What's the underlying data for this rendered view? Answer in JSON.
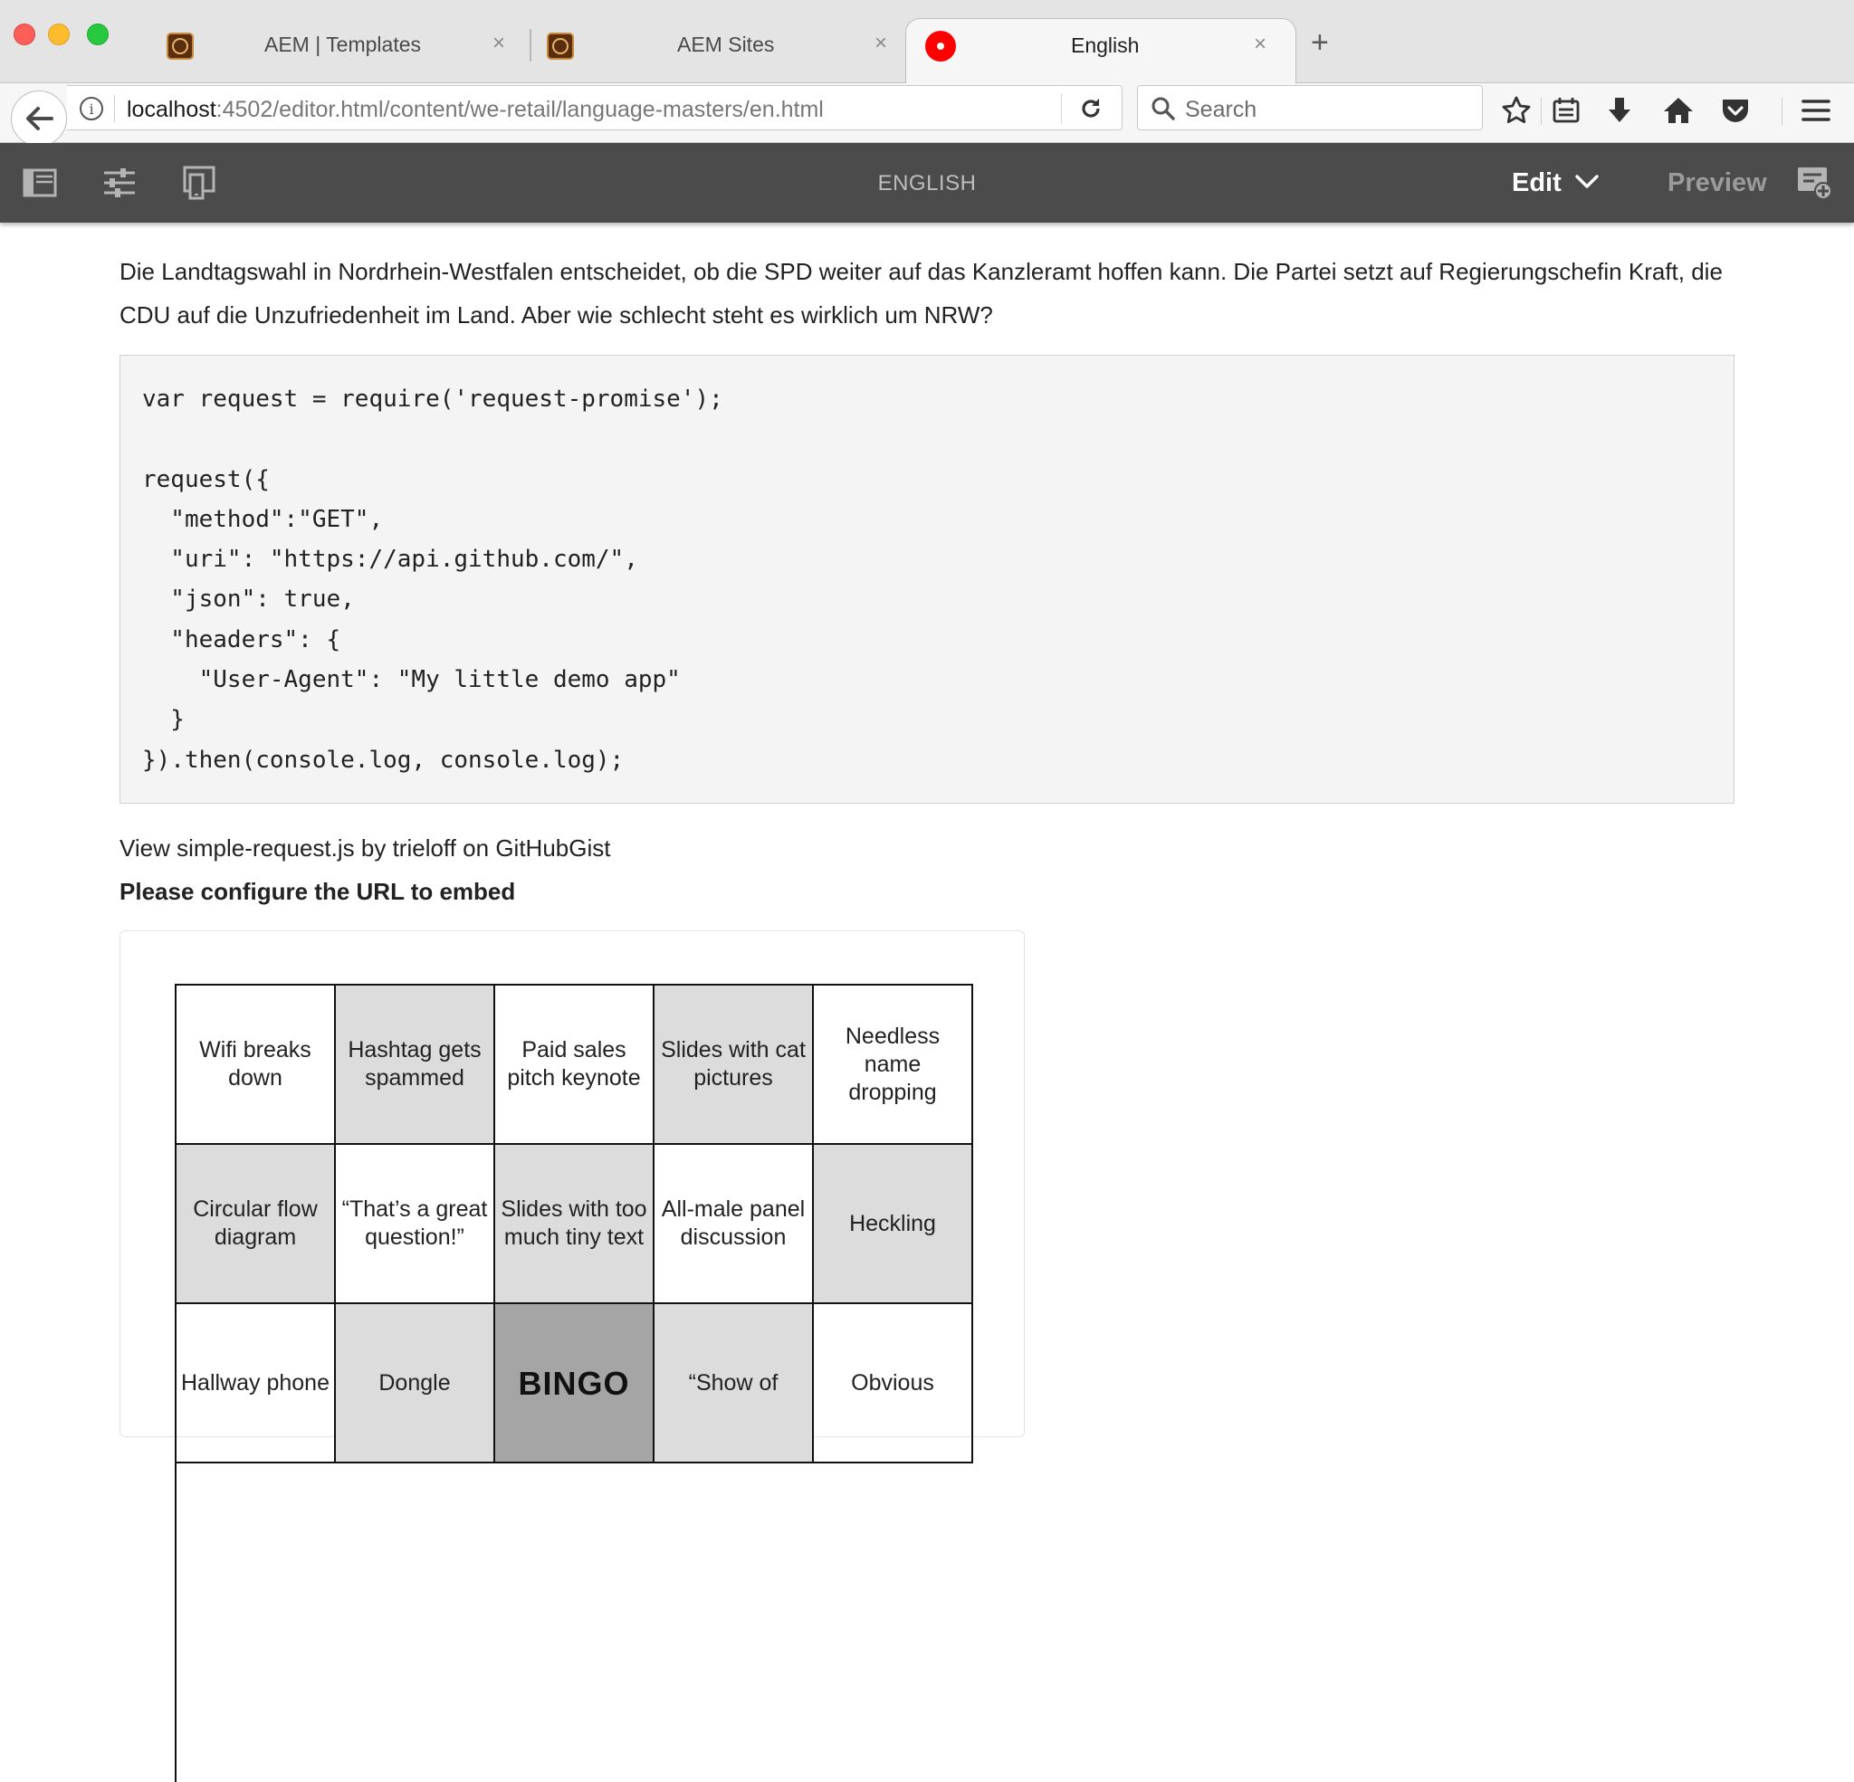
{
  "browser": {
    "tabs": [
      {
        "label": "AEM | Templates",
        "close": "×"
      },
      {
        "label": "AEM Sites",
        "close": "×"
      },
      {
        "label": "English",
        "close": "×",
        "active": true
      }
    ],
    "new_tab": "+",
    "url_host": "localhost",
    "url_path": ":4502/editor.html/content/we-retail/language-masters/en.html",
    "search_placeholder": "Search",
    "favicon_record_color": "#ff0000"
  },
  "aem": {
    "page_title": "ENGLISH",
    "mode": "Edit",
    "preview": "Preview",
    "toolbar_bg": "#4b4b4b"
  },
  "content": {
    "intro": "Die Landtagswahl in Nordrhein-Westfalen entscheidet, ob die SPD weiter auf das Kanzleramt hoffen kann. Die Partei setzt auf Regierungschefin Kraft, die CDU auf die Unzufriedenheit im Land. Aber wie schlecht steht es wirklich um NRW?",
    "code": "var request = require('request-promise');\n\nrequest({\n  \"method\":\"GET\",\n  \"uri\": \"https://api.github.com/\",\n  \"json\": true,\n  \"headers\": {\n    \"User-Agent\": \"My little demo app\"\n  }\n}).then(console.log, console.log);",
    "gist": {
      "view": "View",
      "file": "simple-request.js",
      "by": "by",
      "author": "trieloff",
      "on": "on",
      "service": "GitHubGist"
    },
    "configure": "Please configure the URL to embed",
    "bingo": [
      {
        "text": "Wifi breaks down",
        "shade": "white"
      },
      {
        "text": "Hashtag gets spammed",
        "shade": "grey"
      },
      {
        "text": "Paid sales pitch keynote",
        "shade": "white"
      },
      {
        "text": "Slides with cat pictures",
        "shade": "grey"
      },
      {
        "text": "Needless name dropping",
        "shade": "white"
      },
      {
        "text": "Circular flow diagram",
        "shade": "grey"
      },
      {
        "text": "“That’s a great question!”",
        "shade": "white"
      },
      {
        "text": "Slides with too much tiny text",
        "shade": "grey"
      },
      {
        "text": "All-male panel discussion",
        "shade": "white"
      },
      {
        "text": "Heckling",
        "shade": "grey"
      },
      {
        "text": "Hallway phone",
        "shade": "white"
      },
      {
        "text": "Dongle",
        "shade": "grey"
      },
      {
        "text": "BINGO",
        "shade": "dark"
      },
      {
        "text": "“Show of",
        "shade": "grey"
      },
      {
        "text": "Obvious",
        "shade": "white"
      }
    ]
  }
}
